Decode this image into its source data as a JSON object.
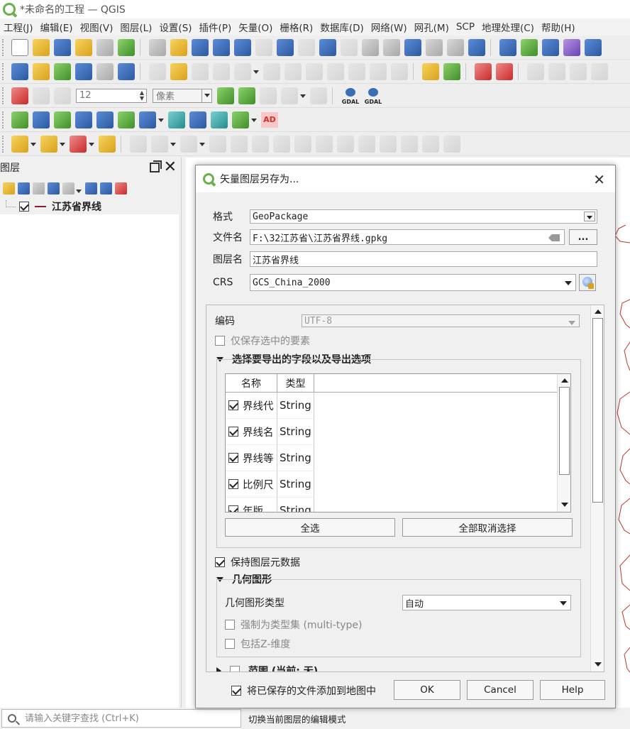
{
  "window": {
    "title": "*未命名的工程 — QGIS"
  },
  "menu": [
    "工程(J)",
    "编辑(E)",
    "视图(V)",
    "图层(L)",
    "设置(S)",
    "插件(P)",
    "矢量(O)",
    "栅格(R)",
    "数据库(D)",
    "网络(W)",
    "网孔(M)",
    "SCP",
    "地理处理(C)",
    "帮助(H)"
  ],
  "toolbar": {
    "snap_tolerance": "12",
    "snap_unit": "像素",
    "gdal_label": "GDAL",
    "ad_label": "AD"
  },
  "layers_panel": {
    "title": "图层",
    "layers": [
      {
        "name": "江苏省界线",
        "checked": true,
        "symbol_color": "#8b1c2c"
      }
    ]
  },
  "dialog": {
    "title": "矢量图层另存为...",
    "format_label": "格式",
    "format_value": "GeoPackage",
    "filename_label": "文件名",
    "filename_value": "F:\\32江苏省\\江苏省界线.gpkg",
    "browse_label": "...",
    "layername_label": "图层名",
    "layername_value": "江苏省界线",
    "crs_label": "CRS",
    "crs_value": "GCS_China_2000",
    "encoding_label": "编码",
    "encoding_value": "UTF-8",
    "save_selected_label": "仅保存选中的要素",
    "fields_section": "选择要导出的字段以及导出选项",
    "fields_table": {
      "col_name": "名称",
      "col_type": "类型",
      "rows": [
        {
          "name": "界线代",
          "type": "String",
          "checked": true
        },
        {
          "name": "界线名",
          "type": "String",
          "checked": true
        },
        {
          "name": "界线等",
          "type": "String",
          "checked": true
        },
        {
          "name": "比例尺",
          "type": "String",
          "checked": true
        },
        {
          "name": "年版",
          "type": "String",
          "checked": true
        }
      ]
    },
    "select_all": "全选",
    "deselect_all": "全部取消选择",
    "persist_metadata_label": "保持图层元数据",
    "geometry_section": "几何图形",
    "geometry_type_label": "几何图形类型",
    "geometry_type_value": "自动",
    "force_multi_label": "强制为类型集 (multi-type)",
    "include_z_label": "包括Z-维度",
    "extent_section": "范围 (当前: 无)",
    "add_to_map_label": "将已保存的文件添加到地图中",
    "ok": "OK",
    "cancel": "Cancel",
    "help": "Help"
  },
  "status": {
    "locator_placeholder": "请输入关键字查找 (Ctrl+K)",
    "message": "切换当前图层的编辑模式"
  },
  "colors": {
    "accent_green": "#6ab04c",
    "layer_line": "#8b1c2c",
    "map_boundary": "#c0392b"
  }
}
